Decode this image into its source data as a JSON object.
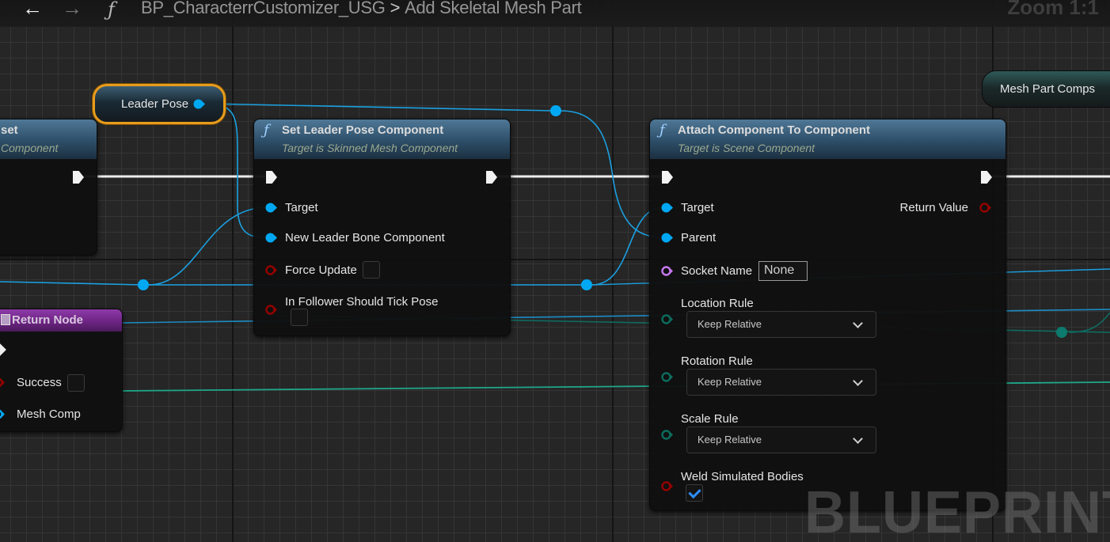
{
  "toolbar": {
    "back_icon": "←",
    "forward_icon": "→",
    "function_icon": "ƒ",
    "breadcrumb": [
      "BP_CharacterrCustomizer_USG",
      "Add Skeletal Mesh Part"
    ],
    "breadcrumb_separator": ">",
    "zoom_label": "Zoom 1:1"
  },
  "colors": {
    "exec_wire": "#ffffff",
    "object_pin": "#00a8f3",
    "bool_pin": "#950000",
    "name_pin": "#c878f0",
    "enum_pin": "#0c6b5e",
    "selection": "#e79c1c",
    "function_header": "#3b6280",
    "return_header": "#7e2e97"
  },
  "nodes": {
    "partial_left": {
      "title": "set",
      "subtitle": "Component"
    },
    "leader_pose_var": {
      "label": "Leader Pose"
    },
    "mesh_part_comps_var": {
      "label": "Mesh Part Comps"
    },
    "set_leader_pose": {
      "fx": "ƒ",
      "title": "Set Leader Pose Component",
      "subtitle": "Target is Skinned Mesh Component",
      "pins": {
        "target": "Target",
        "new_leader": "New Leader Bone Component",
        "force_update": "Force Update",
        "follower_tick": "In Follower Should Tick Pose"
      },
      "force_update_checked": false,
      "follower_tick_checked": false
    },
    "attach": {
      "fx": "ƒ",
      "title": "Attach Component To Component",
      "subtitle": "Target is Scene Component",
      "pins": {
        "target": "Target",
        "parent": "Parent",
        "socket_name": "Socket Name",
        "location_rule": "Location Rule",
        "rotation_rule": "Rotation Rule",
        "scale_rule": "Scale Rule",
        "weld": "Weld Simulated Bodies",
        "return_value": "Return Value"
      },
      "socket_name_value": "None",
      "location_rule_value": "Keep Relative",
      "rotation_rule_value": "Keep Relative",
      "scale_rule_value": "Keep Relative",
      "weld_checked": true
    },
    "return_node": {
      "title": "Return Node",
      "pins": {
        "success": "Success",
        "mesh_comp": "Mesh Comp"
      },
      "success_checked": false
    }
  },
  "watermark": "BLUEPRINT"
}
